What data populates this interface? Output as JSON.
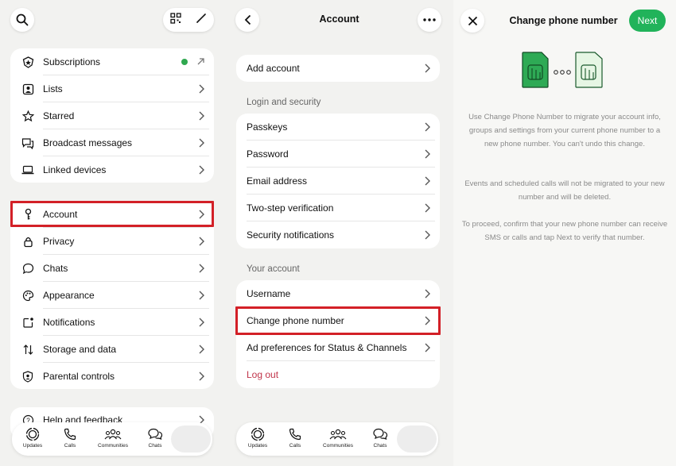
{
  "settings": {
    "tab_labels": [
      "Updates",
      "Calls",
      "Communities",
      "Chats"
    ],
    "card1": [
      "Subscriptions",
      "Lists",
      "Starred",
      "Broadcast messages",
      "Linked devices"
    ],
    "card2": [
      "Account",
      "Privacy",
      "Chats",
      "Appearance",
      "Notifications",
      "Storage and data",
      "Parental controls"
    ],
    "partial_item": "Help and feedback",
    "status_dot_color": "#2fa84f"
  },
  "account": {
    "title": "Account",
    "add_account": "Add account",
    "login_section": "Login and security",
    "login_items": [
      "Passkeys",
      "Password",
      "Email address",
      "Two-step verification",
      "Security notifications"
    ],
    "your_account_section": "Your account",
    "your_items": [
      "Username",
      "Change phone number",
      "Ad preferences for Status & Channels"
    ],
    "logout": "Log out",
    "logout_color": "#c0344a"
  },
  "change_number": {
    "title": "Change phone number",
    "next_label": "Next",
    "accent_color": "#21b35a",
    "para1": "Use Change Phone Number to migrate your account info, groups and settings from your current phone number to a new phone number. You can't undo this change.",
    "para2": "Events and scheduled calls will not be migrated to your new number and will be deleted.",
    "para3": "To proceed, confirm that your new phone number can receive SMS or calls and tap Next to verify that number."
  },
  "highlight_color": "#d32027"
}
